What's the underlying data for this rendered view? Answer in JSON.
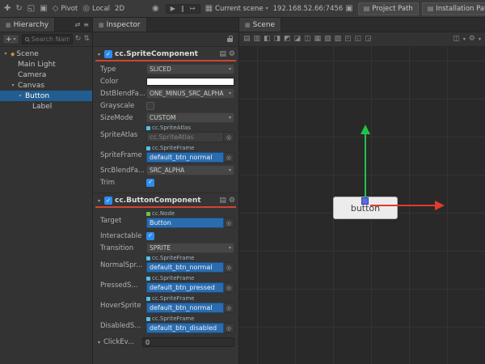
{
  "colors": {
    "selection": "#215d91",
    "accent": "#2d8cf0",
    "asset_field": "#2b6cae",
    "asset_border": "#1d4a7a",
    "underline": "#d0452f",
    "gizmo_green": "#21c24b",
    "gizmo_red": "#e23b2e",
    "gizmo_handle": "#5b6be0"
  },
  "icons": {
    "caret_down": "▾",
    "plus": "+",
    "check": "✓",
    "gear": "⚙",
    "doc": "▤",
    "folder": "▤",
    "copy": "▣",
    "target": "◎",
    "diamond": "◆",
    "pivot": "◇",
    "local": "◎",
    "globe": "◉",
    "scene_box": "▦",
    "refresh": "↻",
    "expand": "⇅",
    "swap": "⇄",
    "menu": "≡",
    "panel": "▦",
    "layers": "◫"
  },
  "top_toolbar": {
    "tools": [
      {
        "name": "move-tool-icon",
        "glyph": "✚"
      },
      {
        "name": "rotate-tool-icon",
        "glyph": "↻"
      },
      {
        "name": "scale-tool-icon",
        "glyph": "◱"
      },
      {
        "name": "rect-tool-icon",
        "glyph": "▣"
      }
    ],
    "pivot_label": "Pivot",
    "local_label": "Local",
    "mode_label": "2D",
    "playback": [
      {
        "name": "play-icon",
        "glyph": "▶"
      },
      {
        "name": "pause-icon",
        "glyph": "‖"
      },
      {
        "name": "step-icon",
        "glyph": "↦"
      }
    ],
    "scene_select_label": "Current scene",
    "address": "192.168.52.66:7456",
    "project_path_label": "Project Path",
    "installation_path_label": "Installation Path"
  },
  "hierarchy": {
    "tab_label": "Hierarchy",
    "search_placeholder": "Search Name...",
    "tree": [
      {
        "label": "Scene",
        "depth": 0,
        "expandable": true,
        "icon": "scene-node-icon",
        "selected": false
      },
      {
        "label": "Main Light",
        "depth": 1,
        "expandable": false,
        "selected": false
      },
      {
        "label": "Camera",
        "depth": 1,
        "expandable": false,
        "selected": false
      },
      {
        "label": "Canvas",
        "depth": 1,
        "expandable": true,
        "selected": false
      },
      {
        "label": "Button",
        "depth": 2,
        "expandable": true,
        "selected": true
      },
      {
        "label": "Label",
        "depth": 3,
        "expandable": false,
        "selected": false
      }
    ]
  },
  "inspector": {
    "tab_label": "Inspector",
    "components": [
      {
        "name": "cc.SpriteComponent",
        "enabled": true,
        "properties": [
          {
            "label": "Type",
            "type": "select",
            "value": "SLICED"
          },
          {
            "label": "Color",
            "type": "color",
            "value": "#FFFFFF"
          },
          {
            "label": "DstBlendFa...",
            "type": "select",
            "value": "ONE_MINUS_SRC_ALPHA"
          },
          {
            "label": "Grayscale",
            "type": "checkbox",
            "value": false
          },
          {
            "label": "SizeMode",
            "type": "select",
            "value": "CUSTOM"
          },
          {
            "label": "SpriteAtlas",
            "type": "asset",
            "asset_type": "cc.SpriteAtlas",
            "value": "cc.SpriteAtlas",
            "empty": true,
            "badge_color": "#4fc1e9"
          },
          {
            "label": "SpriteFrame",
            "type": "asset",
            "asset_type": "cc.SpriteFrame",
            "value": "default_btn_normal",
            "empty": false,
            "badge_color": "#4fc1e9"
          },
          {
            "label": "SrcBlendFa...",
            "type": "select",
            "value": "SRC_ALPHA"
          },
          {
            "label": "Trim",
            "type": "checkbox",
            "value": true
          }
        ]
      },
      {
        "name": "cc.ButtonComponent",
        "enabled": true,
        "properties": [
          {
            "label": "Target",
            "type": "asset",
            "asset_type": "cc.Node",
            "value": "Button",
            "empty": false,
            "badge_color": "#7bc043"
          },
          {
            "label": "Interactable",
            "type": "checkbox",
            "value": true
          },
          {
            "label": "Transition",
            "type": "select",
            "value": "SPRITE"
          },
          {
            "label": "NormalSpr...",
            "type": "asset",
            "asset_type": "cc.SpriteFrame",
            "value": "default_btn_normal",
            "empty": false,
            "badge_color": "#4fc1e9"
          },
          {
            "label": "PressedS...",
            "type": "asset",
            "asset_type": "cc.SpriteFrame",
            "value": "default_btn_pressed",
            "empty": false,
            "badge_color": "#4fc1e9"
          },
          {
            "label": "HoverSprite",
            "type": "asset",
            "asset_type": "cc.SpriteFrame",
            "value": "default_btn_normal",
            "empty": false,
            "badge_color": "#4fc1e9"
          },
          {
            "label": "DisabledS...",
            "type": "asset",
            "asset_type": "cc.SpriteFrame",
            "value": "default_btn_disabled",
            "empty": false,
            "badge_color": "#4fc1e9"
          }
        ]
      }
    ],
    "click_events_label": "ClickEv...",
    "click_events_count": "0"
  },
  "scene": {
    "tab_label": "Scene",
    "toolbar_icons": [
      {
        "name": "grid-icon",
        "glyph": "▤"
      },
      {
        "name": "wireframe-icon",
        "glyph": "▥"
      },
      {
        "name": "align-top-icon",
        "glyph": "◧"
      },
      {
        "name": "align-middle-icon",
        "glyph": "◨"
      },
      {
        "name": "align-bottom-icon",
        "glyph": "◩"
      },
      {
        "name": "align-left-icon",
        "glyph": "◪"
      },
      {
        "name": "align-center-icon",
        "glyph": "◫"
      },
      {
        "name": "align-right-icon",
        "glyph": "▦"
      },
      {
        "name": "distribute-top-icon",
        "glyph": "▧"
      },
      {
        "name": "distribute-middle-icon",
        "glyph": "▨"
      },
      {
        "name": "distribute-left-icon",
        "glyph": "◰"
      },
      {
        "name": "distribute-center-icon",
        "glyph": "◱"
      },
      {
        "name": "distribute-right-icon",
        "glyph": "◲"
      }
    ],
    "button_label": "button"
  }
}
